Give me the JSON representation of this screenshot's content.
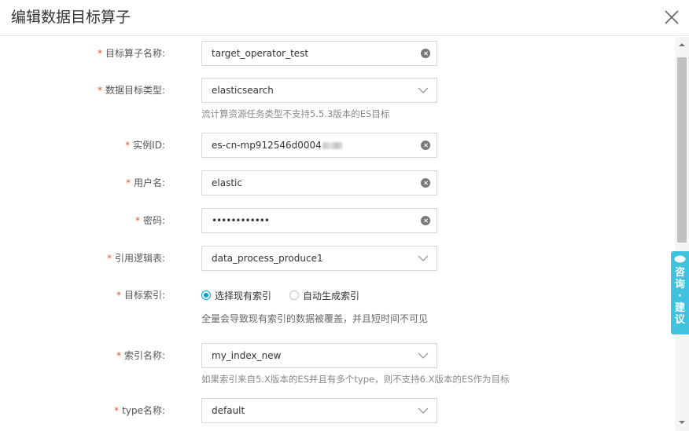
{
  "dialog": {
    "title": "编辑数据目标算子"
  },
  "form": {
    "operator_name": {
      "label": "目标算子名称:",
      "value": "target_operator_test"
    },
    "target_type": {
      "label": "数据目标类型:",
      "value": "elasticsearch",
      "hint": "流计算资源任务类型不支持5.5.3版本的ES目标"
    },
    "instance_id": {
      "label": "实例ID:",
      "value": "es-cn-mp912546d0004"
    },
    "username": {
      "label": "用户名:",
      "value": "elastic"
    },
    "password": {
      "label": "密码:",
      "value": "••••••••••••"
    },
    "logical_table": {
      "label": "引用逻辑表:",
      "value": "data_process_produce1"
    },
    "target_index": {
      "label": "目标索引:",
      "options": [
        "选择现有索引",
        "自动生成索引"
      ],
      "selected": 0,
      "hint": "全量会导致现有索引的数据被覆盖，并且短时间不可见"
    },
    "index_name": {
      "label": "索引名称:",
      "value": "my_index_new",
      "hint": "如果索引来自5.X版本的ES并且有多个type，则不支持6.X版本的ES作为目标"
    },
    "type_name": {
      "label": "type名称:",
      "value": "default"
    },
    "required_mark": "*"
  },
  "feedback": {
    "chars": [
      "咨",
      "询",
      "·",
      "建",
      "议"
    ]
  },
  "colors": {
    "accent": "#00a2ca",
    "required": "#e0552d",
    "feedback_tab": "#3fc2dd"
  },
  "icons": {
    "close": "close-icon",
    "clear": "clear-icon",
    "dropdown": "chevron-down-icon",
    "feedback": "chat-icon"
  }
}
